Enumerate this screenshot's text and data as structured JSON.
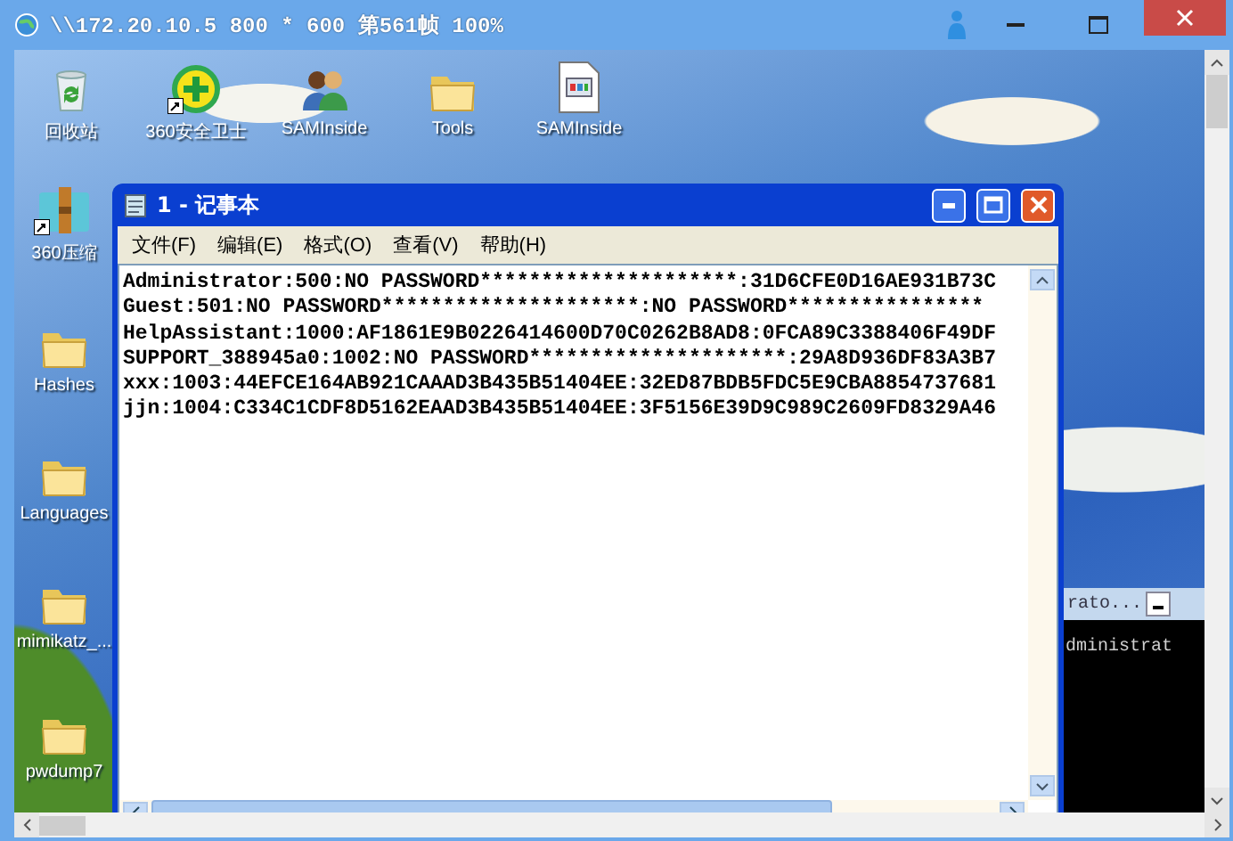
{
  "remote_window": {
    "title": "\\\\172.20.10.5 800 * 600 第561帧 100%"
  },
  "desktop_icons": [
    {
      "label": "回收站",
      "kind": "recycle",
      "shortcut": false
    },
    {
      "label": "360安全卫士",
      "kind": "shield",
      "shortcut": true
    },
    {
      "label": "SAMInside",
      "kind": "users",
      "shortcut": false
    },
    {
      "label": "Tools",
      "kind": "folder",
      "shortcut": false
    },
    {
      "label": "SAMInside",
      "kind": "document",
      "shortcut": false
    },
    {
      "label": "360压缩",
      "kind": "archive",
      "shortcut": true
    },
    {
      "label": "Hashes",
      "kind": "folder",
      "shortcut": false
    },
    {
      "label": "Languages",
      "kind": "folder",
      "shortcut": false
    },
    {
      "label": "mimikatz_...",
      "kind": "folder",
      "shortcut": false
    },
    {
      "label": "pwdump7",
      "kind": "folder",
      "shortcut": false
    }
  ],
  "notepad": {
    "title": "1 - 记事本",
    "menu": [
      "文件(F)",
      "编辑(E)",
      "格式(O)",
      "查看(V)",
      "帮助(H)"
    ],
    "lines": [
      "Administrator:500:NO PASSWORD*********************:31D6CFE0D16AE931B73C",
      "Guest:501:NO PASSWORD*********************:NO PASSWORD****************",
      "HelpAssistant:1000:AF1861E9B0226414600D70C0262B8AD8:0FCA89C3388406F49DF",
      "SUPPORT_388945a0:1002:NO PASSWORD*********************:29A8D936DF83A3B7",
      "xxx:1003:44EFCE164AB921CAAAD3B435B51404EE:32ED87BDB5FDC5E9CBA8854737681",
      "jjn:1004:C334C1CDF8D5162EAAD3B435B51404EE:3F5156E39D9C989C2609FD8329A46"
    ]
  },
  "console_window": {
    "title": "rato...",
    "line": "dministrat"
  }
}
